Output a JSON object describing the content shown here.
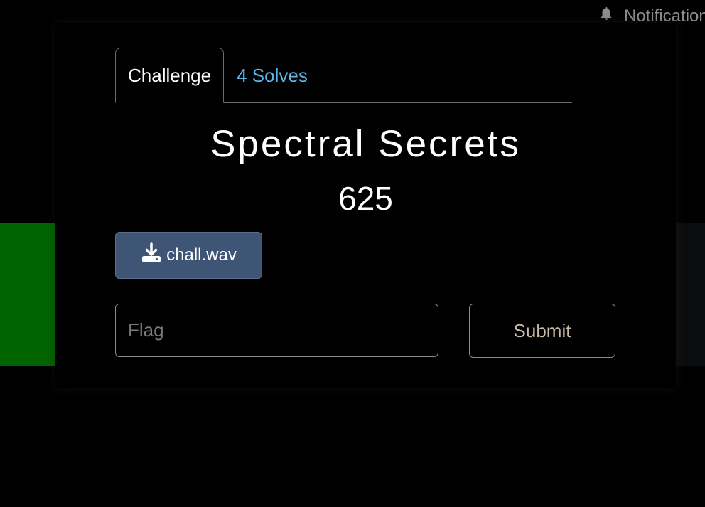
{
  "notification": {
    "label": "Notifications",
    "icon": "bell-icon"
  },
  "modal": {
    "tabs": [
      {
        "label": "Challenge",
        "active": true
      },
      {
        "label": "4 Solves",
        "active": false
      }
    ],
    "title": "Spectral Secrets",
    "points": "625",
    "file": {
      "label": "chall.wav",
      "icon": "download-icon"
    },
    "flag": {
      "placeholder": "Flag",
      "value": ""
    },
    "submit_label": "Submit"
  },
  "colors": {
    "background": "#000000",
    "link": "#5db4e6",
    "file_button": "#3f5575",
    "submit_text": "#c8bba8",
    "left_panel": "#006400"
  }
}
